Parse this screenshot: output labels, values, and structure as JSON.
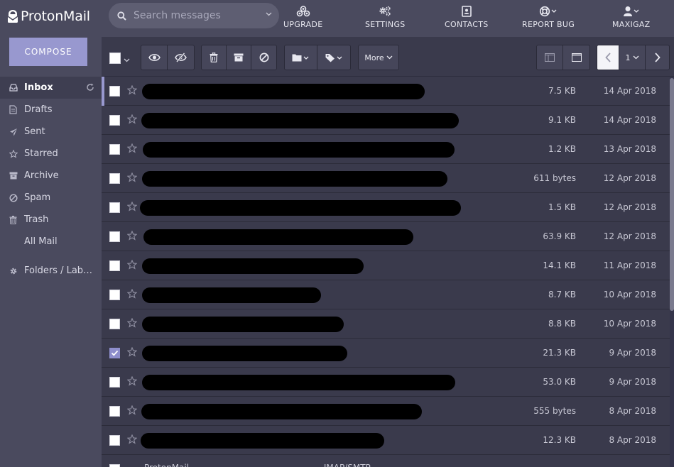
{
  "brand": {
    "name": "ProtonMail"
  },
  "compose_label": "COMPOSE",
  "search": {
    "placeholder": "Search messages"
  },
  "topnav": [
    {
      "label": "UPGRADE",
      "icon": "upgrade-icon"
    },
    {
      "label": "SETTINGS",
      "icon": "gears-icon"
    },
    {
      "label": "CONTACTS",
      "icon": "contacts-icon"
    },
    {
      "label": "REPORT BUG",
      "icon": "lifebuoy-icon"
    },
    {
      "label": "MAXIGAZ",
      "icon": "user-icon"
    }
  ],
  "sidebar": {
    "items": [
      {
        "label": "Inbox",
        "icon": "inbox-icon",
        "active": true
      },
      {
        "label": "Drafts",
        "icon": "file-icon"
      },
      {
        "label": "Sent",
        "icon": "paper-plane-icon"
      },
      {
        "label": "Starred",
        "icon": "star-icon"
      },
      {
        "label": "Archive",
        "icon": "archive-icon"
      },
      {
        "label": "Spam",
        "icon": "ban-icon"
      },
      {
        "label": "Trash",
        "icon": "trash-icon"
      },
      {
        "label": "All Mail",
        "icon": ""
      }
    ],
    "folders_label": "Folders / Lab…"
  },
  "toolbar": {
    "more_label": "More",
    "page_number": "1"
  },
  "messages": [
    {
      "size": "7.5 KB",
      "date": "14 Apr 2018",
      "checked": false
    },
    {
      "size": "9.1 KB",
      "date": "14 Apr 2018",
      "checked": false
    },
    {
      "size": "1.2 KB",
      "date": "13 Apr 2018",
      "checked": false
    },
    {
      "size": "611 bytes",
      "date": "12 Apr 2018",
      "checked": false
    },
    {
      "size": "1.5 KB",
      "date": "12 Apr 2018",
      "checked": false
    },
    {
      "size": "63.9 KB",
      "date": "12 Apr 2018",
      "checked": false
    },
    {
      "size": "14.1 KB",
      "date": "11 Apr 2018",
      "checked": false
    },
    {
      "size": "8.7 KB",
      "date": "10 Apr 2018",
      "checked": false
    },
    {
      "size": "8.8 KB",
      "date": "10 Apr 2018",
      "checked": false
    },
    {
      "size": "21.3 KB",
      "date": "9 Apr 2018",
      "checked": true
    },
    {
      "size": "53.0 KB",
      "date": "9 Apr 2018",
      "checked": false
    },
    {
      "size": "555 bytes",
      "date": "8 Apr 2018",
      "checked": false
    },
    {
      "size": "12.3 KB",
      "date": "8 Apr 2018",
      "checked": false
    }
  ],
  "partial_row_text": "ProtonMail — — — — — — — — — — — —IMAP/SMTP"
}
